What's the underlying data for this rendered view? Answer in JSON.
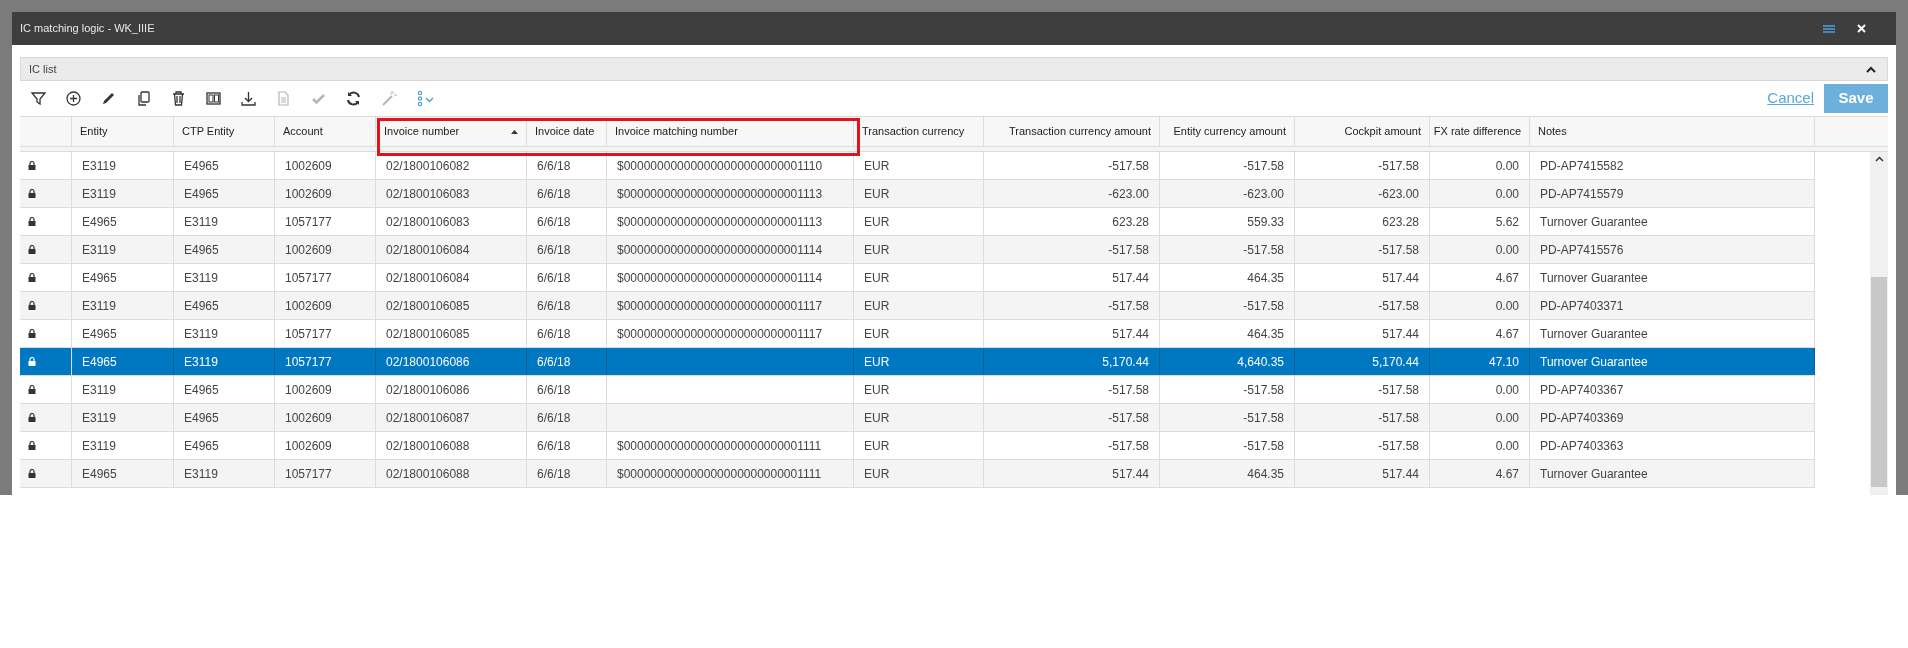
{
  "window": {
    "title": "IC matching logic - WK_IIIE"
  },
  "panel": {
    "title": "IC list",
    "expanded": true
  },
  "toolbar": [
    {
      "kind": "filter",
      "disabled": false
    },
    {
      "kind": "add",
      "disabled": false
    },
    {
      "kind": "edit",
      "disabled": false
    },
    {
      "kind": "copy",
      "disabled": false
    },
    {
      "kind": "delete",
      "disabled": false
    },
    {
      "kind": "columns",
      "disabled": false
    },
    {
      "kind": "download",
      "disabled": false
    },
    {
      "kind": "document",
      "disabled": true
    },
    {
      "kind": "check",
      "disabled": true
    },
    {
      "kind": "refresh",
      "disabled": false
    },
    {
      "kind": "wand",
      "disabled": true
    },
    {
      "kind": "more",
      "disabled": false
    }
  ],
  "actions": {
    "cancel": "Cancel",
    "save": "Save"
  },
  "table": {
    "columns": [
      {
        "label": "Entity",
        "kind": "text",
        "sorted": false
      },
      {
        "label": "CTP Entity",
        "kind": "text",
        "sorted": false
      },
      {
        "label": "Account",
        "kind": "text",
        "sorted": false
      },
      {
        "label": "Invoice number",
        "kind": "text",
        "sorted": true
      },
      {
        "label": "Invoice date",
        "kind": "text",
        "sorted": false
      },
      {
        "label": "Invoice matching number",
        "kind": "text",
        "sorted": false
      },
      {
        "label": "Transaction currency",
        "kind": "text",
        "sorted": false
      },
      {
        "label": "Transaction currency amount",
        "kind": "amount",
        "sorted": false
      },
      {
        "label": "Entity currency amount",
        "kind": "amount",
        "sorted": false
      },
      {
        "label": "Cockpit amount",
        "kind": "amount",
        "sorted": false
      },
      {
        "label": "FX rate difference",
        "kind": "amount",
        "sorted": false
      },
      {
        "label": "Notes",
        "kind": "text",
        "sorted": false
      }
    ],
    "rows": [
      {
        "locked": true,
        "selected": false,
        "cells": [
          "E3119",
          "E4965",
          "1002609",
          "02/1800106082",
          "6/6/18",
          "$000000000000000000000000001110",
          "EUR",
          "-517.58",
          "-517.58",
          "-517.58",
          "0.00",
          "PD-AP7415582"
        ]
      },
      {
        "locked": true,
        "selected": false,
        "cells": [
          "E3119",
          "E4965",
          "1002609",
          "02/1800106083",
          "6/6/18",
          "$000000000000000000000000001113",
          "EUR",
          "-623.00",
          "-623.00",
          "-623.00",
          "0.00",
          "PD-AP7415579"
        ]
      },
      {
        "locked": true,
        "selected": false,
        "cells": [
          "E4965",
          "E3119",
          "1057177",
          "02/1800106083",
          "6/6/18",
          "$000000000000000000000000001113",
          "EUR",
          "623.28",
          "559.33",
          "623.28",
          "5.62",
          "Turnover Guarantee"
        ]
      },
      {
        "locked": true,
        "selected": false,
        "cells": [
          "E3119",
          "E4965",
          "1002609",
          "02/1800106084",
          "6/6/18",
          "$000000000000000000000000001114",
          "EUR",
          "-517.58",
          "-517.58",
          "-517.58",
          "0.00",
          "PD-AP7415576"
        ]
      },
      {
        "locked": true,
        "selected": false,
        "cells": [
          "E4965",
          "E3119",
          "1057177",
          "02/1800106084",
          "6/6/18",
          "$000000000000000000000000001114",
          "EUR",
          "517.44",
          "464.35",
          "517.44",
          "4.67",
          "Turnover Guarantee"
        ]
      },
      {
        "locked": true,
        "selected": false,
        "cells": [
          "E3119",
          "E4965",
          "1002609",
          "02/1800106085",
          "6/6/18",
          "$000000000000000000000000001117",
          "EUR",
          "-517.58",
          "-517.58",
          "-517.58",
          "0.00",
          "PD-AP7403371"
        ]
      },
      {
        "locked": true,
        "selected": false,
        "cells": [
          "E4965",
          "E3119",
          "1057177",
          "02/1800106085",
          "6/6/18",
          "$000000000000000000000000001117",
          "EUR",
          "517.44",
          "464.35",
          "517.44",
          "4.67",
          "Turnover Guarantee"
        ]
      },
      {
        "locked": true,
        "selected": true,
        "cells": [
          "E4965",
          "E3119",
          "1057177",
          "02/1800106086",
          "6/6/18",
          "",
          "EUR",
          "5,170.44",
          "4,640.35",
          "5,170.44",
          "47.10",
          "Turnover Guarantee"
        ]
      },
      {
        "locked": true,
        "selected": false,
        "cells": [
          "E3119",
          "E4965",
          "1002609",
          "02/1800106086",
          "6/6/18",
          "",
          "EUR",
          "-517.58",
          "-517.58",
          "-517.58",
          "0.00",
          "PD-AP7403367"
        ]
      },
      {
        "locked": true,
        "selected": false,
        "cells": [
          "E3119",
          "E4965",
          "1002609",
          "02/1800106087",
          "6/6/18",
          "",
          "EUR",
          "-517.58",
          "-517.58",
          "-517.58",
          "0.00",
          "PD-AP7403369"
        ]
      },
      {
        "locked": true,
        "selected": false,
        "cells": [
          "E3119",
          "E4965",
          "1002609",
          "02/1800106088",
          "6/6/18",
          "$000000000000000000000000001111",
          "EUR",
          "-517.58",
          "-517.58",
          "-517.58",
          "0.00",
          "PD-AP7403363"
        ]
      },
      {
        "locked": true,
        "selected": false,
        "cells": [
          "E4965",
          "E3119",
          "1057177",
          "02/1800106088",
          "6/6/18",
          "$000000000000000000000000001111",
          "EUR",
          "517.44",
          "464.35",
          "517.44",
          "4.67",
          "Turnover Guarantee"
        ]
      }
    ]
  }
}
